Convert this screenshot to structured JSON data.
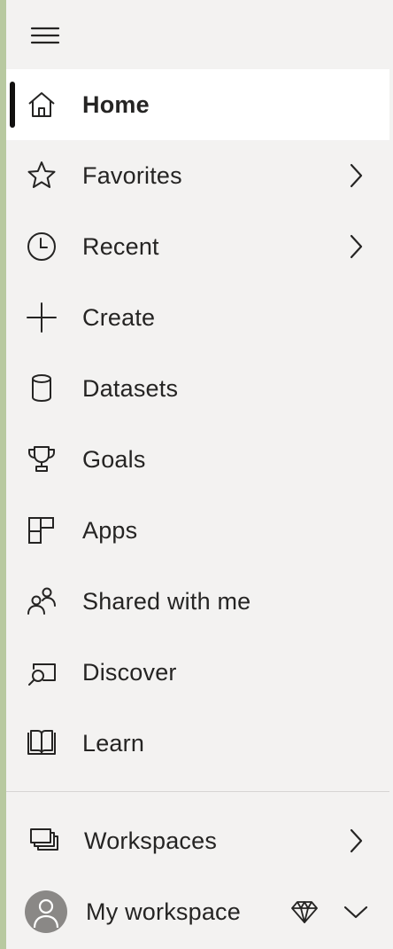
{
  "nav": {
    "menu_icon": "hamburger-menu-icon",
    "items": [
      {
        "label": "Home",
        "icon": "home-icon",
        "active": true,
        "has_chevron": false
      },
      {
        "label": "Favorites",
        "icon": "star-icon",
        "active": false,
        "has_chevron": true
      },
      {
        "label": "Recent",
        "icon": "clock-icon",
        "active": false,
        "has_chevron": true
      },
      {
        "label": "Create",
        "icon": "plus-icon",
        "active": false,
        "has_chevron": false
      },
      {
        "label": "Datasets",
        "icon": "database-icon",
        "active": false,
        "has_chevron": false
      },
      {
        "label": "Goals",
        "icon": "trophy-icon",
        "active": false,
        "has_chevron": false
      },
      {
        "label": "Apps",
        "icon": "apps-icon",
        "active": false,
        "has_chevron": false
      },
      {
        "label": "Shared with me",
        "icon": "people-icon",
        "active": false,
        "has_chevron": false
      },
      {
        "label": "Discover",
        "icon": "discover-icon",
        "active": false,
        "has_chevron": false
      },
      {
        "label": "Learn",
        "icon": "book-icon",
        "active": false,
        "has_chevron": false
      }
    ],
    "workspaces": {
      "label": "Workspaces",
      "icon": "workspaces-icon",
      "has_chevron": true
    },
    "my_workspace": {
      "label": "My workspace",
      "icon": "avatar-icon",
      "badge_icon": "diamond-icon",
      "expand_icon": "chevron-down-icon"
    }
  },
  "colors": {
    "background": "#f3f2f1",
    "active_background": "#ffffff",
    "active_indicator": "#11100f",
    "text": "#252423",
    "accent_strip": "#b8c9a0",
    "avatar": "#8a8886"
  }
}
